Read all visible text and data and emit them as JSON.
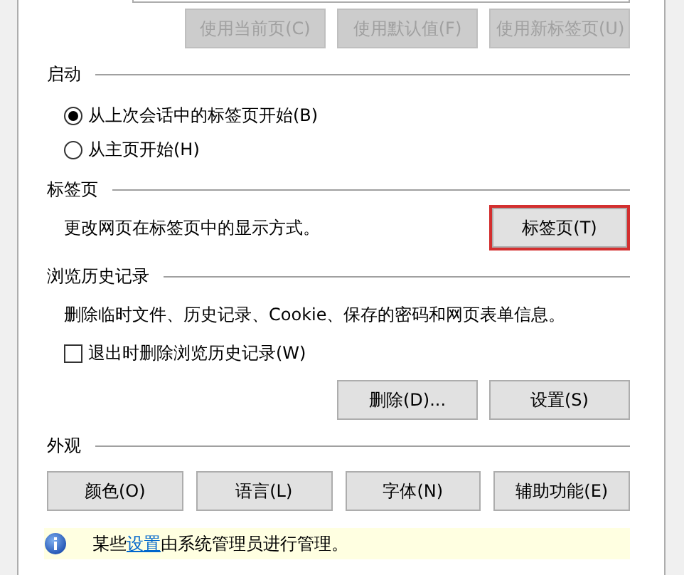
{
  "home_page_buttons": [
    {
      "label": "使用当前页(C)",
      "disabled": true
    },
    {
      "label": "使用默认值(F)",
      "disabled": true
    },
    {
      "label": "使用新标签页(U)",
      "disabled": true
    }
  ],
  "startup": {
    "title": "启动",
    "options": [
      {
        "label": "从上次会话中的标签页开始(B)",
        "selected": true
      },
      {
        "label": "从主页开始(H)",
        "selected": false
      }
    ]
  },
  "tabs": {
    "title": "标签页",
    "description": "更改网页在标签页中的显示方式。",
    "button": {
      "label": "标签页(T)",
      "highlighted": true
    }
  },
  "browsing_history": {
    "title": "浏览历史记录",
    "description": "删除临时文件、历史记录、Cookie、保存的密码和网页表单信息。",
    "checkbox": {
      "label": "退出时删除浏览历史记录(W)",
      "checked": false
    },
    "buttons": [
      {
        "label": "删除(D)...",
        "disabled": false
      },
      {
        "label": "设置(S)",
        "disabled": false
      }
    ]
  },
  "appearance": {
    "title": "外观",
    "buttons": [
      {
        "label": "颜色(O)",
        "disabled": false
      },
      {
        "label": "语言(L)",
        "disabled": false
      },
      {
        "label": "字体(N)",
        "disabled": false
      },
      {
        "label": "辅助功能(E)",
        "disabled": false
      }
    ]
  },
  "notice": {
    "before": "某些",
    "link": "设置",
    "after": "由系统管理员进行管理。"
  }
}
